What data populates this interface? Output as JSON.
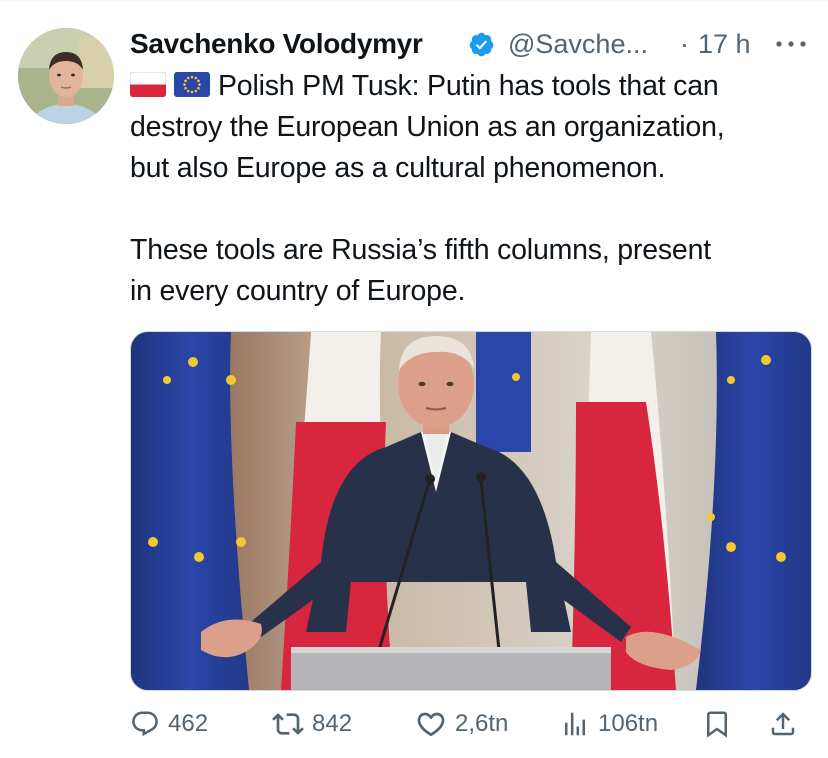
{
  "author": {
    "display_name": "Savchenko Volodymyr",
    "handle": "@Savche...",
    "separator": "·",
    "time": "17 h",
    "verified": true
  },
  "tweet": {
    "flags": [
      "poland-flag",
      "eu-flag"
    ],
    "lines": [
      "Polish PM Tusk: Putin has tools that can",
      "destroy the European Union as an organization,",
      "but also Europe as a cultural phenomenon.",
      "",
      "These tools are Russia’s fifth columns, present",
      "in every country of Europe."
    ]
  },
  "actions": {
    "replies": "462",
    "reposts": "842",
    "likes": "2,6tn",
    "views": "106tn"
  },
  "colors": {
    "text": "#0f1419",
    "secondary": "#536471",
    "verified": "#1d9bf0",
    "eu_blue": "#2a46a8",
    "eu_star": "#f3c730",
    "poland_red": "#d7263d"
  }
}
